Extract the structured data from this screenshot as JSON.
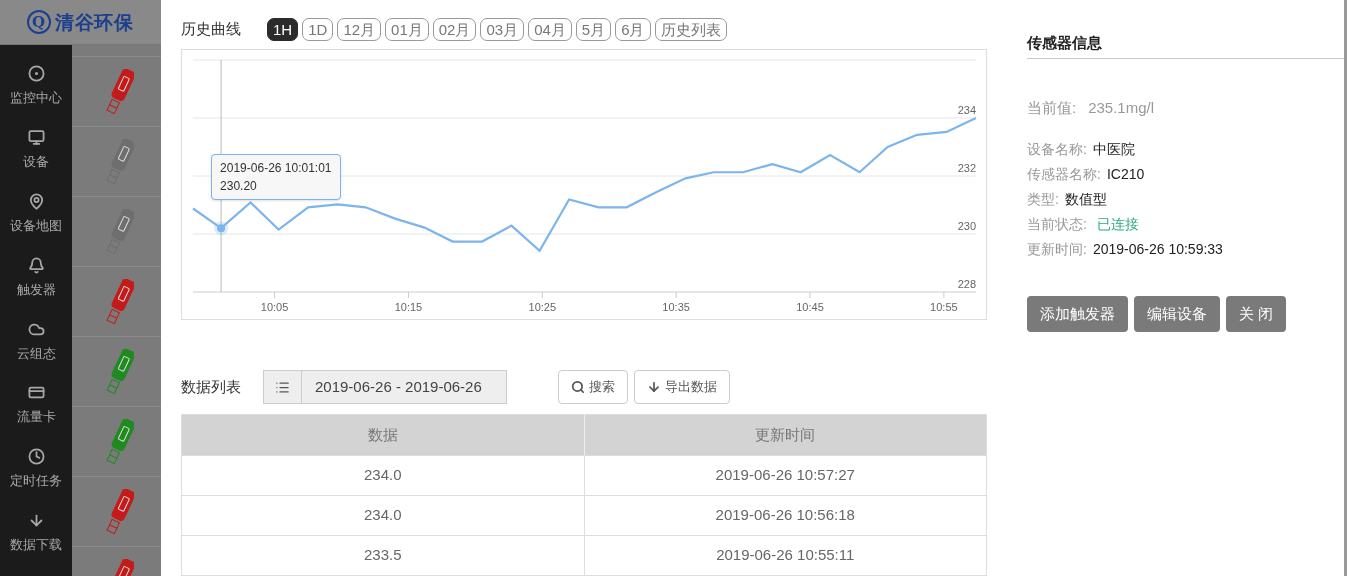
{
  "logo": {
    "mark": "Q",
    "name": "清谷环保"
  },
  "sidebar": {
    "items": [
      {
        "label": "监控中心"
      },
      {
        "label": "设备"
      },
      {
        "label": "设备地图"
      },
      {
        "label": "触发器"
      },
      {
        "label": "云组态"
      },
      {
        "label": "流量卡"
      },
      {
        "label": "定时任务"
      },
      {
        "label": "数据下载"
      }
    ]
  },
  "devices": [
    {
      "color": "#c41a1a"
    },
    {
      "color": "#6e6e6e"
    },
    {
      "color": "#6e6e6e"
    },
    {
      "color": "#c41a1a"
    },
    {
      "color": "#1f8a1f"
    },
    {
      "color": "#1f8a1f"
    },
    {
      "color": "#c41a1a"
    },
    {
      "color": "#c41a1a"
    }
  ],
  "history": {
    "title": "历史曲线",
    "ranges": [
      {
        "label": "1H",
        "selected": true
      },
      {
        "label": "1D",
        "selected": false
      },
      {
        "label": "12月",
        "selected": false
      },
      {
        "label": "01月",
        "selected": false
      },
      {
        "label": "02月",
        "selected": false
      },
      {
        "label": "03月",
        "selected": false
      },
      {
        "label": "04月",
        "selected": false
      },
      {
        "label": "5月",
        "selected": false
      },
      {
        "label": "6月",
        "selected": false
      },
      {
        "label": "历史列表",
        "selected": false
      }
    ],
    "chart_data": {
      "type": "line",
      "x": [
        9.9817,
        10.0167,
        10.0533,
        10.0883,
        10.125,
        10.1617,
        10.1967,
        10.2333,
        10.27,
        10.305,
        10.3417,
        10.3783,
        10.4133,
        10.45,
        10.4867,
        10.5217,
        10.5583,
        10.595,
        10.63,
        10.6667,
        10.7033,
        10.7383,
        10.775,
        10.8117,
        10.8467,
        10.8833,
        10.92,
        10.9567
      ],
      "series": [
        {
          "color": "#7cb5ec",
          "values": [
            230.88,
            230.2,
            231.09,
            230.15,
            230.92,
            231.02,
            230.92,
            230.53,
            230.22,
            229.74,
            229.74,
            230.29,
            229.42,
            231.19,
            230.92,
            230.92,
            231.44,
            231.92,
            232.13,
            232.13,
            232.41,
            232.13,
            232.72,
            232.13,
            233.0,
            233.42,
            233.52,
            234.0
          ]
        }
      ],
      "grid": true,
      "ref_lines": [
        {
          "axis": "x",
          "value": 10.0167,
          "color": "#bbbbbb"
        }
      ],
      "xlim": [
        9.9817,
        10.9567
      ],
      "ylim": [
        228,
        236
      ],
      "xticks": [
        {
          "value": 10.0833,
          "label": "10:05"
        },
        {
          "value": 10.25,
          "label": "10:15"
        },
        {
          "value": 10.4167,
          "label": "10:25"
        },
        {
          "value": 10.5833,
          "label": "10:35"
        },
        {
          "value": 10.75,
          "label": "10:45"
        },
        {
          "value": 10.9167,
          "label": "10:55"
        }
      ],
      "yticks": [
        228,
        230,
        232,
        234
      ],
      "annotations": [
        {
          "x": 10.0167,
          "y": 230.2,
          "text": "2019-06-26 10:01:01\n230.20"
        }
      ]
    }
  },
  "data_list": {
    "title": "数据列表",
    "date_range": "2019-06-26 - 2019-06-26",
    "search_button": "搜索",
    "export_button": "导出数据",
    "table": {
      "columns": [
        "数据",
        "更新时间"
      ],
      "rows": [
        [
          "234.0",
          "2019-06-26 10:57:27"
        ],
        [
          "234.0",
          "2019-06-26 10:56:18"
        ],
        [
          "233.5",
          "2019-06-26 10:55:11"
        ]
      ]
    }
  },
  "sensor_info": {
    "title": "传感器信息",
    "current_label": "当前值:",
    "current_value": "235.1mg/l",
    "fields": [
      {
        "label": "设备名称:",
        "value": "中医院"
      },
      {
        "label": "传感器名称:",
        "value": "IC210"
      },
      {
        "label": "类型:",
        "value": "数值型"
      }
    ],
    "status": {
      "label": "当前状态:",
      "value": "已连接",
      "connected": true
    },
    "updated": {
      "label": "更新时间:",
      "value": "2019-06-26 10:59:33"
    },
    "buttons": [
      "添加触发器",
      "编辑设备",
      "关 闭"
    ]
  }
}
